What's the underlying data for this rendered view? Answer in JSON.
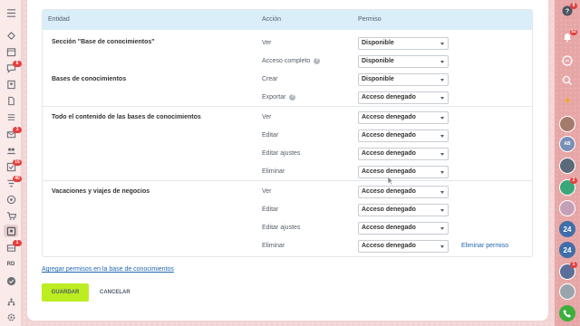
{
  "table": {
    "headers": {
      "entity": "Entidad",
      "action": "Acción",
      "permission": "Permiso"
    },
    "groups": [
      {
        "entity": "Sección \"Base de conocimientos\"",
        "rows": [
          {
            "action": "Ver",
            "help": false,
            "permission": "Disponible"
          },
          {
            "action": "Acceso completo",
            "help": true,
            "permission": "Disponible"
          }
        ]
      },
      {
        "entity": "Bases de conocimientos",
        "rows": [
          {
            "action": "Crear",
            "help": false,
            "permission": "Disponible"
          },
          {
            "action": "Exportar",
            "help": true,
            "permission": "Acceso denegado"
          }
        ]
      },
      {
        "entity": "Todo el contenido de las bases de conocimientos",
        "rows": [
          {
            "action": "Ver",
            "help": false,
            "permission": "Acceso denegado"
          },
          {
            "action": "Editar",
            "help": false,
            "permission": "Acceso denegado"
          },
          {
            "action": "Editar ajustes",
            "help": false,
            "permission": "Acceso denegado"
          },
          {
            "action": "Eliminar",
            "help": false,
            "permission": "Acceso denegado"
          }
        ]
      },
      {
        "entity": "Vacaciones y viajes de negocios",
        "remove_label": "Eliminar permiso",
        "rows": [
          {
            "action": "Ver",
            "help": false,
            "permission": "Acceso denegado"
          },
          {
            "action": "Editar",
            "help": false,
            "permission": "Acceso denegado"
          },
          {
            "action": "Editar ajustes",
            "help": false,
            "permission": "Acceso denegado"
          },
          {
            "action": "Eliminar",
            "help": false,
            "permission": "Acceso denegado"
          }
        ]
      }
    ]
  },
  "add_permission_link": "Agregar permisos en la base de conocimientos",
  "buttons": {
    "save": "GUARDAR",
    "cancel": "CANCELAR"
  },
  "left_sidebar": {
    "user_initials": "RD",
    "badges": {
      "messages": "6",
      "mail": "3",
      "tasks": "15",
      "filters": "40",
      "drive": "1"
    }
  },
  "right_sidebar": {
    "help_badge": "8",
    "notifications_badge": "52",
    "avatar_badges": {
      "avatar3": "2",
      "avatar6": "1"
    },
    "avatar_initials_24a": "24",
    "avatar_initials_24b": "24",
    "avatar_bot_label": "AB"
  },
  "colors": {
    "accent_green": "#bbed21",
    "link_blue": "#2067b0",
    "header_blue": "#d9eef8",
    "badge_red": "#e53e3e",
    "right_bar": "#e7a6a6"
  }
}
